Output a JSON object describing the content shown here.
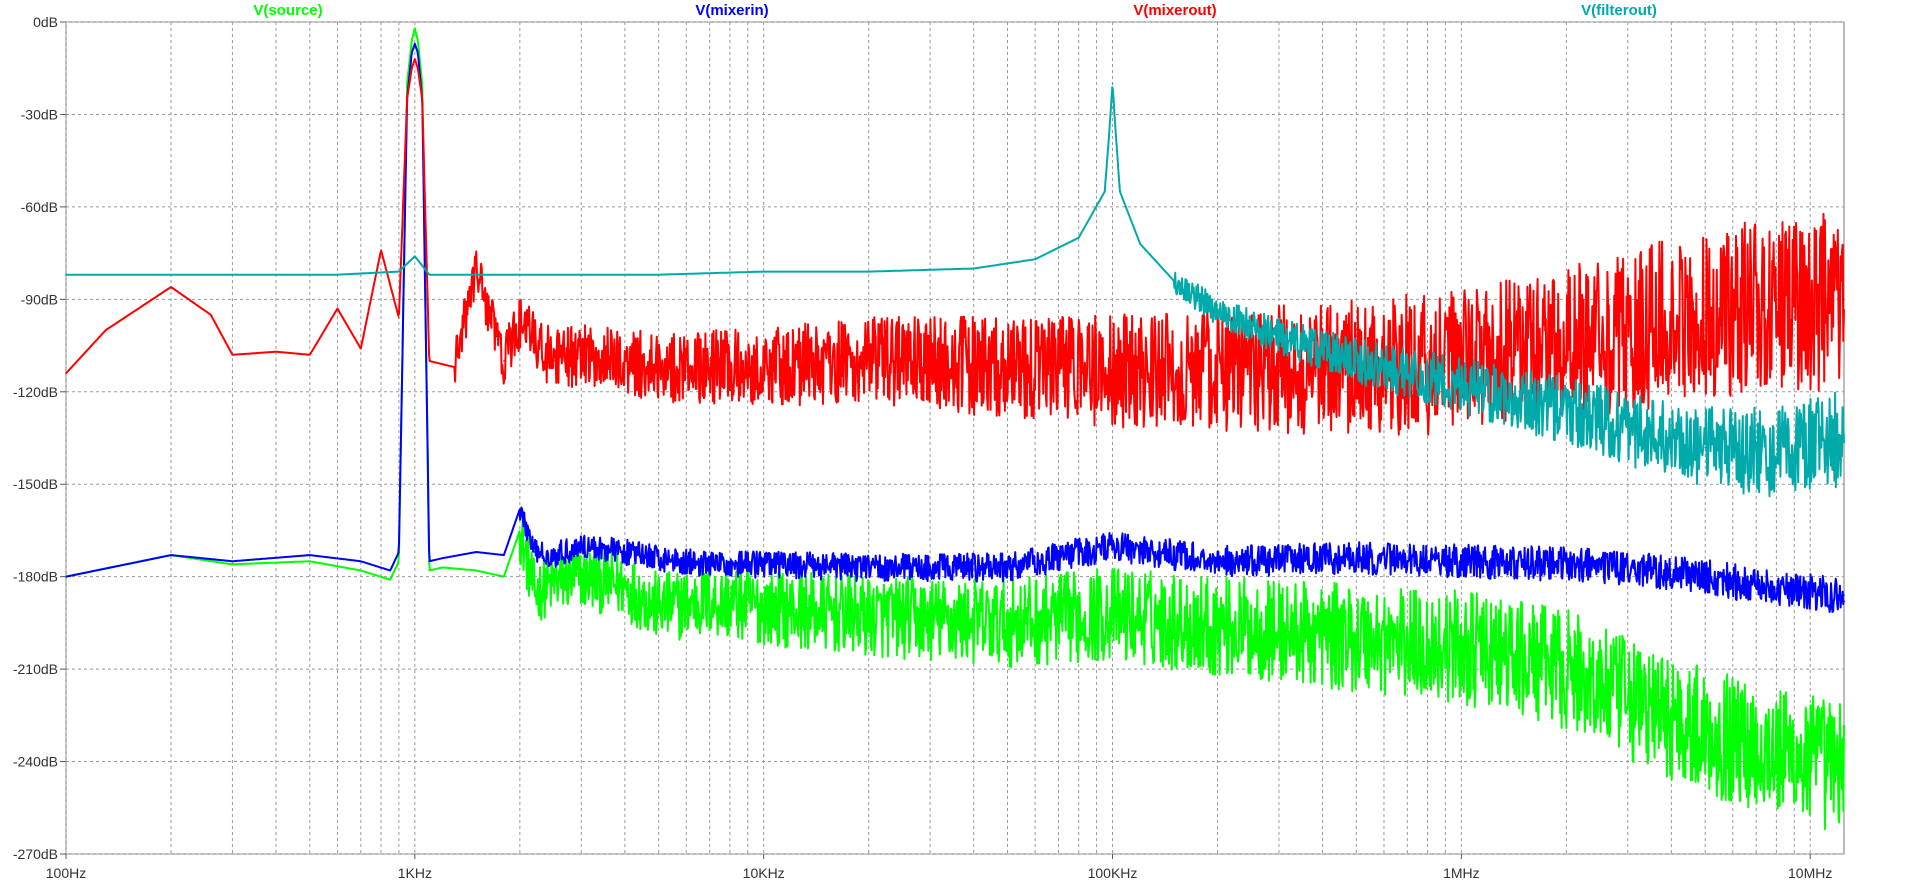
{
  "chart_data": {
    "type": "line",
    "title": "",
    "xlabel": "",
    "ylabel": "",
    "x_scale": "log",
    "xlim": [
      100,
      12500000
    ],
    "ylim": [
      -270,
      0
    ],
    "grid": true,
    "legend_position": "top",
    "x_major_tick_values": [
      100,
      1000,
      10000,
      100000,
      1000000,
      10000000
    ],
    "x_tick_labels": [
      "100Hz",
      "1KHz",
      "10KHz",
      "100KHz",
      "1MHz",
      "10MHz"
    ],
    "y_tick_values": [
      0,
      -30,
      -60,
      -90,
      -120,
      -150,
      -180,
      -210,
      -240,
      -270
    ],
    "y_tick_labels": [
      "0dB",
      "-30dB",
      "-60dB",
      "-90dB",
      "-120dB",
      "-150dB",
      "-180dB",
      "-210dB",
      "-240dB",
      "-270dB"
    ],
    "series": [
      {
        "name": "V(source)",
        "color": "#00ff00",
        "x": [
          100,
          200,
          300,
          500,
          700,
          850,
          900,
          950,
          980,
          1000,
          1020,
          1050,
          1100,
          1200,
          1500,
          1800,
          2000,
          2200,
          2500,
          3000,
          4000,
          5000,
          7000,
          10000,
          20000,
          50000,
          100000,
          200000,
          500000,
          1000000,
          2000000,
          3000000,
          5000000,
          8000000,
          12500000
        ],
        "y": [
          -180,
          -173,
          -176,
          -175,
          -178,
          -181,
          -175,
          -20,
          -6,
          -2,
          -6,
          -20,
          -178,
          -177,
          -178,
          -180,
          -165,
          -185,
          -182,
          -180,
          -183,
          -190,
          -188,
          -190,
          -193,
          -195,
          -192,
          -196,
          -200,
          -203,
          -210,
          -220,
          -230,
          -237,
          -242
        ],
        "noise_from": 2000,
        "noise_amp_start": 10,
        "noise_amp_end": 22
      },
      {
        "name": "V(mixerin)",
        "color": "#0000ff",
        "x": [
          100,
          200,
          300,
          500,
          700,
          850,
          900,
          950,
          980,
          1000,
          1020,
          1050,
          1100,
          1200,
          1500,
          1800,
          2000,
          2200,
          2500,
          3000,
          4000,
          5000,
          7000,
          10000,
          20000,
          50000,
          100000,
          200000,
          500000,
          1000000,
          2000000,
          3000000,
          5000000,
          8000000,
          12500000
        ],
        "y": [
          -180,
          -173,
          -175,
          -173,
          -175,
          -178,
          -172,
          -25,
          -10,
          -7,
          -10,
          -25,
          -175,
          -174,
          -172,
          -173,
          -158,
          -172,
          -173,
          -170,
          -172,
          -174,
          -176,
          -176,
          -177,
          -177,
          -170,
          -175,
          -174,
          -175,
          -176,
          -177,
          -180,
          -184,
          -186
        ],
        "noise_from": 2000,
        "noise_amp_start": 4,
        "noise_amp_end": 6
      },
      {
        "name": "V(mixerout)",
        "color": "#ff0000",
        "x": [
          100,
          130,
          200,
          260,
          300,
          400,
          500,
          600,
          700,
          800,
          900,
          950,
          980,
          1000,
          1020,
          1050,
          1100,
          1300,
          1500,
          1800,
          2000,
          2500,
          3000,
          5000,
          10000,
          20000,
          50000,
          100000,
          200000,
          300000,
          500000,
          1000000,
          2000000,
          3000000,
          5000000,
          8000000,
          12500000
        ],
        "y": [
          -114,
          -100,
          -86,
          -95,
          -108,
          -107,
          -108,
          -93,
          -106,
          -74,
          -96,
          -25,
          -15,
          -12,
          -15,
          -25,
          -110,
          -112,
          -80,
          -110,
          -98,
          -110,
          -108,
          -112,
          -112,
          -110,
          -112,
          -113,
          -114,
          -113,
          -112,
          -110,
          -105,
          -100,
          -95,
          -92,
          -90
        ],
        "noise_from": 1300,
        "noise_amp_start": 8,
        "noise_amp_end": 30
      },
      {
        "name": "V(filterout)",
        "color": "#00aaaa",
        "x": [
          100,
          300,
          600,
          900,
          1000,
          1100,
          2000,
          5000,
          10000,
          20000,
          40000,
          60000,
          80000,
          95000,
          98000,
          100000,
          102000,
          105000,
          120000,
          150000,
          200000,
          300000,
          500000,
          1000000,
          2000000,
          3000000,
          5000000,
          8000000,
          12500000
        ],
        "y": [
          -82,
          -82,
          -82,
          -81,
          -76,
          -82,
          -82,
          -82,
          -81,
          -81,
          -80,
          -77,
          -70,
          -55,
          -35,
          -20,
          -35,
          -55,
          -72,
          -84,
          -94,
          -102,
          -110,
          -118,
          -126,
          -132,
          -138,
          -140,
          -135
        ],
        "noise_from": 150000,
        "noise_amp_start": 4,
        "noise_amp_end": 16
      }
    ]
  }
}
